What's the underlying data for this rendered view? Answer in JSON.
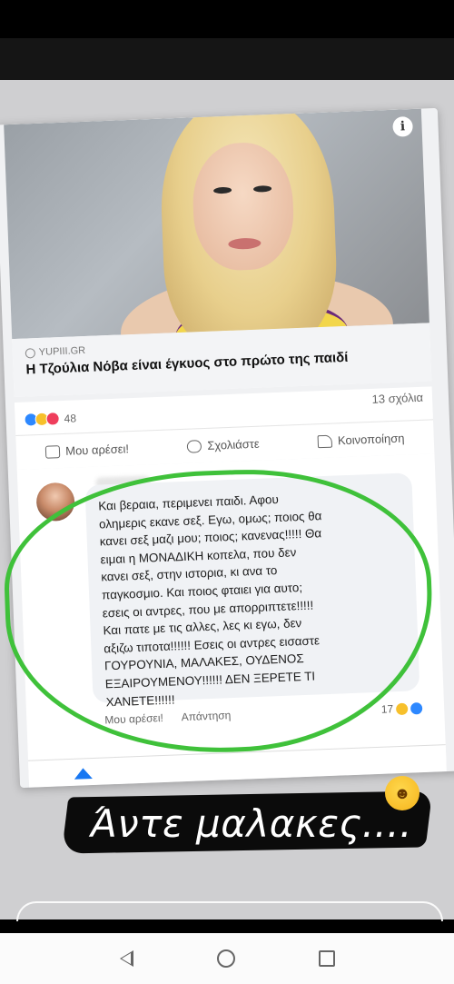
{
  "post": {
    "source": "YUPIII.GR",
    "headline": "Η Τζούλια Νόβα είναι έγκυος στο πρώτο της παιδί",
    "reaction_count": "48",
    "comment_count": "13 σχόλια"
  },
  "actions": {
    "like": "Μου αρέσει!",
    "comment": "Σχολιάστε",
    "share": "Κοινοποίηση"
  },
  "comment": {
    "text": "Και βεραια, περιμενει παιδι. Αφου\nολημερις εκανε σεξ. Εγω, ομως; ποιος θα\nκανει σεξ μαζι μου; ποιος; κανενας!!!!! Θα\nειμαι η ΜΟΝΑΔΙΚΗ κοπελα, που δεν\nκανει σεξ, στην ιστορια, κι ανα το\nπαγκοσμιο. Και ποιος φταιει για αυτο;\nεσεις οι αντρες, που με απορριπτετε!!!!!\nΚαι πατε με τις αλλες, λες κι εγω, δεν\nαξιζω τιποτα!!!!!! Εσεις οι αντρες εισαστε\nΓΟΥΡΟΥΝΙΑ, ΜΑΛΑΚΕΣ, ΟΥΔΕΝΟΣ\nΕΞΑΙΡΟΥΜΕΝΟΥ!!!!!! ΔΕΝ ΞΕΡΕΤΕ ΤΙ\nΧΑΝΕΤΕ!!!!!!",
    "like_label": "Μου αρέσει!",
    "reply_label": "Απάντηση",
    "reaction_count": "17"
  },
  "story": {
    "caption": "Άντε μαλακες...."
  },
  "colors": {
    "highlight_ring": "#3fc13a",
    "facebook_blue": "#1877f2"
  }
}
